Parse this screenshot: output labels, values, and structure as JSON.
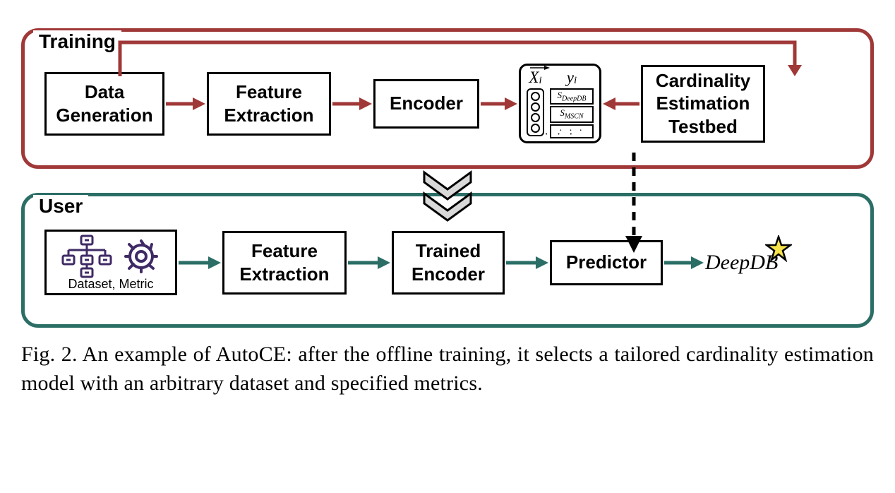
{
  "panels": {
    "training": {
      "label": "Training"
    },
    "user": {
      "label": "User"
    }
  },
  "training_row": {
    "data_gen": {
      "l1": "Data",
      "l2": "Generation"
    },
    "feat_ext": {
      "l1": "Feature",
      "l2": "Extraction"
    },
    "encoder": "Encoder",
    "xy": {
      "x_label_base": "X",
      "x_label_sub": "i",
      "y_label_base": "y",
      "y_label_sub": "i",
      "s1_base": "S",
      "s1_sub": "DeepDB",
      "s2_base": "S",
      "s2_sub": "MSCN",
      "dots": "· · ·",
      "bottom": "· · ·"
    },
    "testbed": {
      "l1": "Cardinality",
      "l2": "Estimation",
      "l3": "Testbed"
    }
  },
  "user_row": {
    "input_caption": "Dataset, Metric",
    "feat_ext": {
      "l1": "Feature",
      "l2": "Extraction"
    },
    "trained_enc": {
      "l1": "Trained",
      "l2": "Encoder"
    },
    "predictor": "Predictor",
    "output": "DeepDB"
  },
  "caption": "Fig. 2.  An example of AutoCE: after the offline training, it selects a tailored cardinality estimation model with an arbitrary dataset and specified metrics.",
  "colors": {
    "train_arrow": "#a03838",
    "user_arrow": "#2b6e66",
    "icon_purple": "#3f2a66"
  }
}
